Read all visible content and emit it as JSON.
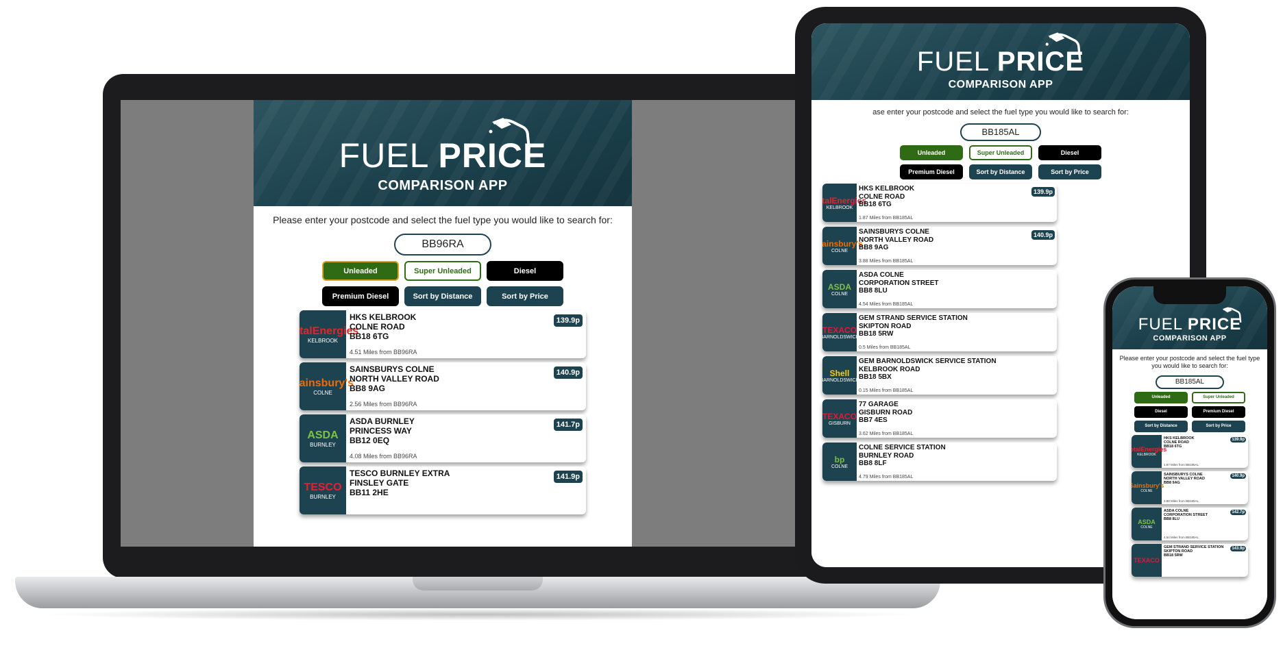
{
  "app": {
    "title_thin": "FUEL",
    "title_bold": "PRICE",
    "subtitle": "COMPARISON APP",
    "prompt": "Please enter your postcode and select the fuel type you would like to search for:",
    "prompt_tablet": "ase enter your postcode and select the fuel type you would like to search for:",
    "buttons": {
      "unleaded": "Unleaded",
      "super_unleaded": "Super Unleaded",
      "diesel": "Diesel",
      "premium_diesel": "Premium Diesel",
      "sort_distance": "Sort by Distance",
      "sort_price": "Sort by Price"
    }
  },
  "colors": {
    "header": "#1e4350",
    "unleaded": "#2f6b14",
    "selected_outline": "#d9a320"
  },
  "laptop": {
    "postcode": "BB96RA",
    "stations": [
      {
        "brand": "TotalEnergies",
        "location": "KELBROOK",
        "name": "HKS KELBROOK",
        "road": "COLNE ROAD",
        "postcode": "BB18 6TG",
        "distance": "4.51 Miles from BB96RA",
        "price": "139.9p"
      },
      {
        "brand": "Sainsbury's",
        "location": "COLNE",
        "name": "SAINSBURYS COLNE",
        "road": "NORTH VALLEY ROAD",
        "postcode": "BB8 9AG",
        "distance": "2.56 Miles from BB96RA",
        "price": "140.9p"
      },
      {
        "brand": "ASDA",
        "location": "BURNLEY",
        "name": "ASDA BURNLEY",
        "road": "PRINCESS WAY",
        "postcode": "BB12 0EQ",
        "distance": "4.08 Miles from BB96RA",
        "price": "141.7p"
      },
      {
        "brand": "TESCO",
        "location": "BURNLEY",
        "name": "TESCO BURNLEY EXTRA",
        "road": "FINSLEY GATE",
        "postcode": "BB11 2HE",
        "distance": "",
        "price": "141.9p"
      }
    ]
  },
  "tablet": {
    "postcode": "BB185AL",
    "stations": [
      {
        "brand": "TotalEnergies",
        "location": "KELBROOK",
        "name": "HKS KELBROOK",
        "road": "COLNE ROAD",
        "postcode": "BB18 6TG",
        "distance": "1.87 Miles from BB185AL",
        "price": "139.9p"
      },
      {
        "brand": "Sainsbury's",
        "location": "COLNE",
        "name": "SAINSBURYS COLNE",
        "road": "NORTH VALLEY ROAD",
        "postcode": "BB8 9AG",
        "distance": "3.88 Miles from BB185AL",
        "price": "140.9p"
      },
      {
        "brand": "ASDA",
        "location": "COLNE",
        "name": "ASDA COLNE",
        "road": "CORPORATION STREET",
        "postcode": "BB8 8LU",
        "distance": "4.54 Miles from BB185AL",
        "price": ""
      },
      {
        "brand": "TEXACO",
        "location": "BARNOLDSWICK",
        "name": "GEM STRAND SERVICE STATION",
        "road": "SKIPTON ROAD",
        "postcode": "BB18 5RW",
        "distance": "0.5 Miles from BB185AL",
        "price": ""
      },
      {
        "brand": "Shell",
        "location": "BARNOLDSWICK",
        "name": "GEM BARNOLDSWICK SERVICE STATION",
        "road": "KELBROOK ROAD",
        "postcode": "BB18 5BX",
        "distance": "0.15 Miles from BB185AL",
        "price": ""
      },
      {
        "brand": "TEXACO",
        "location": "GISBURN",
        "name": "77 GARAGE",
        "road": "GISBURN ROAD",
        "postcode": "BB7 4ES",
        "distance": "3.62 Miles from BB185AL",
        "price": ""
      },
      {
        "brand": "bp",
        "location": "COLNE",
        "name": "COLNE SERVICE STATION",
        "road": "BURNLEY ROAD",
        "postcode": "BB8 8LF",
        "distance": "4.79 Miles from BB185AL",
        "price": ""
      }
    ]
  },
  "phone": {
    "postcode": "BB185AL",
    "stations": [
      {
        "brand": "TotalEnergies",
        "location": "KELBROOK",
        "name": "HKS KELBROOK",
        "road": "COLNE ROAD",
        "postcode": "BB18 6TG",
        "distance": "1.87 Miles from BB185AL",
        "price": "139.9p"
      },
      {
        "brand": "Sainsbury's",
        "location": "COLNE",
        "name": "SAINSBURYS COLNE",
        "road": "NORTH VALLEY ROAD",
        "postcode": "BB8 9AG",
        "distance": "3.88 Miles from BB185AL",
        "price": "140.9p"
      },
      {
        "brand": "ASDA",
        "location": "COLNE",
        "name": "ASDA COLNE",
        "road": "CORPORATION STREET",
        "postcode": "BB8 8LU",
        "distance": "4.54 Miles from BB185AL",
        "price": "142.7p"
      },
      {
        "brand": "TEXACO",
        "location": "",
        "name": "GEM STRAND SERVICE STATION",
        "road": "SKIPTON ROAD",
        "postcode": "BB18 5RW",
        "distance": "",
        "price": "143.9p"
      }
    ]
  }
}
